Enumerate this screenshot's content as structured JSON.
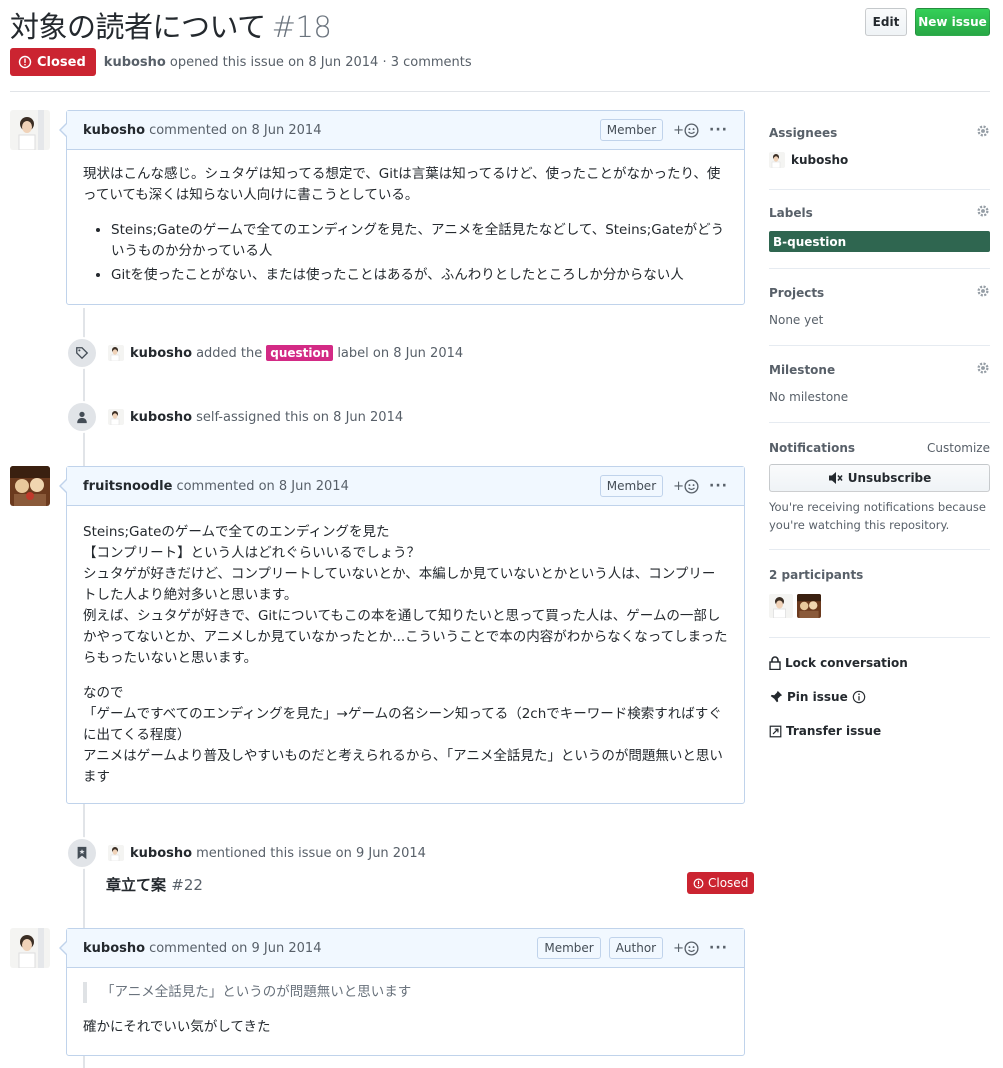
{
  "header": {
    "title": "対象の読者について",
    "number": "#18",
    "edit_label": "Edit",
    "new_issue_label": "New issue",
    "state": "Closed",
    "author": "kubosho",
    "meta_text": "opened this issue on 8 Jun 2014 · 3 comments"
  },
  "comments": [
    {
      "author": "kubosho",
      "meta": "commented on 8 Jun 2014",
      "roles": [
        "Member"
      ],
      "paragraph": "現状はこんな感じ。シュタゲは知ってる想定で、Gitは言葉は知ってるけど、使ったことがなかったり、使っていても深くは知らない人向けに書こうとしている。",
      "bullets": [
        "Steins;Gateのゲームで全てのエンディングを見た、アニメを全話見たなどして、Steins;Gateがどういうものか分かっている人",
        "Gitを使ったことがない、または使ったことはあるが、ふんわりとしたところしか分からない人"
      ]
    },
    {
      "author": "fruitsnoodle",
      "meta": "commented on 8 Jun 2014",
      "roles": [
        "Member"
      ],
      "lines_p1": [
        "Steins;Gateのゲームで全てのエンディングを見た",
        "【コンプリート】という人はどれぐらいいるでしょう？",
        "シュタゲが好きだけど、コンプリートしていないとか、本編しか見ていないとかという人は、コンプリートした人より絶対多いと思います。",
        "例えば、シュタゲが好きで、Gitについてもこの本を通して知りたいと思って買った人は、ゲームの一部しかやってないとか、アニメしか見ていなかったとか...こういうことで本の内容がわからなくなってしまったらもったいないと思います。"
      ],
      "lines_p2": [
        "なので",
        "「ゲームですべてのエンディングを見た」→ゲームの名シーン知ってる（2chでキーワード検索すればすぐに出てくる程度）",
        "アニメはゲームより普及しやすいものだと考えられるから、「アニメ全話見た」というのが問題無いと思います"
      ]
    },
    {
      "author": "kubosho",
      "meta": "commented on 9 Jun 2014",
      "roles": [
        "Member",
        "Author"
      ],
      "quote": "「アニメ全話見た」というのが問題無いと思います",
      "text": "確かにそれでいい気がしてきた"
    }
  ],
  "events": [
    {
      "actor": "kubosho",
      "pre": "added the",
      "label": "question",
      "post": "label on 8 Jun 2014"
    },
    {
      "actor": "kubosho",
      "text": "self-assigned this on 8 Jun 2014"
    },
    {
      "actor": "kubosho",
      "text": "mentioned this issue on 9 Jun 2014",
      "ref_title": "章立て案",
      "ref_number": "#22",
      "ref_state": "Closed"
    }
  ],
  "sidebar": {
    "assignees_title": "Assignees",
    "assignee": "kubosho",
    "labels_title": "Labels",
    "label": "B-question",
    "label_color": "#2f6650",
    "projects_title": "Projects",
    "projects_value": "None yet",
    "milestone_title": "Milestone",
    "milestone_value": "No milestone",
    "notifications_title": "Notifications",
    "customize": "Customize",
    "unsubscribe": "Unsubscribe",
    "notif_note": "You're receiving notifications because you're watching this repository.",
    "participants": "2 participants",
    "lock": "Lock conversation",
    "pin": "Pin issue",
    "transfer": "Transfer issue"
  },
  "colors": {
    "closed": "#cb2431",
    "question_label": "#d32a85",
    "comment_border": "#c0d3eb",
    "comment_header": "#f1f8ff"
  }
}
